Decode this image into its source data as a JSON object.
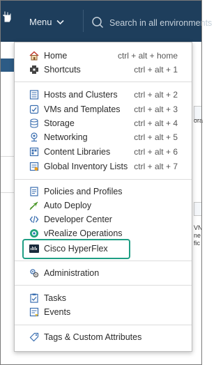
{
  "header": {
    "menu_label": "Menu",
    "search_placeholder": "Search in all environments"
  },
  "menu": {
    "items": [
      {
        "label": "Home",
        "shortcut": "ctrl + alt + home",
        "icon": "home-icon"
      },
      {
        "label": "Shortcuts",
        "shortcut": "ctrl + alt + 1",
        "icon": "shortcuts-icon"
      },
      {
        "label": "Hosts and Clusters",
        "shortcut": "ctrl + alt + 2",
        "icon": "hosts-clusters-icon"
      },
      {
        "label": "VMs and Templates",
        "shortcut": "ctrl + alt + 3",
        "icon": "vms-templates-icon"
      },
      {
        "label": "Storage",
        "shortcut": "ctrl + alt + 4",
        "icon": "storage-icon"
      },
      {
        "label": "Networking",
        "shortcut": "ctrl + alt + 5",
        "icon": "networking-icon"
      },
      {
        "label": "Content Libraries",
        "shortcut": "ctrl + alt + 6",
        "icon": "content-libraries-icon"
      },
      {
        "label": "Global Inventory Lists",
        "shortcut": "ctrl + alt + 7",
        "icon": "global-inventory-icon"
      },
      {
        "label": "Policies and Profiles",
        "icon": "policies-icon"
      },
      {
        "label": "Auto Deploy",
        "icon": "auto-deploy-icon"
      },
      {
        "label": "Developer Center",
        "icon": "developer-center-icon"
      },
      {
        "label": "vRealize Operations",
        "icon": "vrealize-icon"
      },
      {
        "label": "Cisco HyperFlex",
        "icon": "cisco-hyperflex-icon"
      },
      {
        "label": "Administration",
        "icon": "administration-icon"
      },
      {
        "label": "Tasks",
        "icon": "tasks-icon"
      },
      {
        "label": "Events",
        "icon": "events-icon"
      },
      {
        "label": "Tags & Custom Attributes",
        "icon": "tags-icon"
      }
    ]
  },
  "background": {
    "right_fragments": [
      "ora",
      "VN",
      "ne",
      "fic"
    ]
  },
  "colors": {
    "header_bg": "#1e3e5c",
    "highlight_border": "#1f9e84"
  }
}
